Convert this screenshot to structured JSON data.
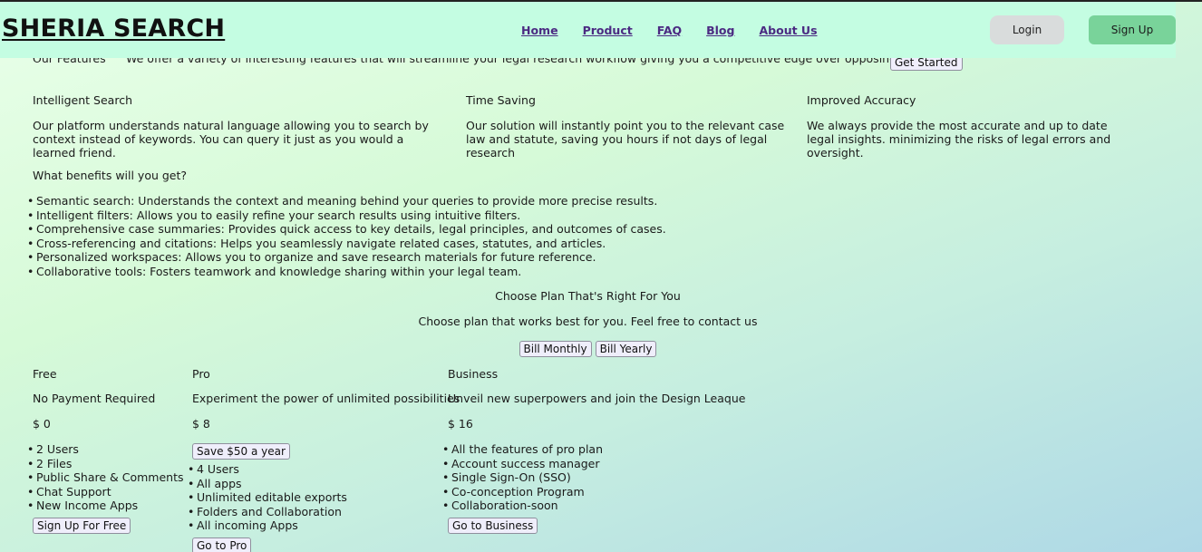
{
  "nav": {
    "logo": "SHERIA SEARCH",
    "links": [
      "Home",
      "Product",
      "FAQ",
      "Blog",
      "About Us"
    ],
    "login": "Login",
    "signup": "Sign Up"
  },
  "hero_partial": {
    "label": "Our Features",
    "desc": "We offer a variety of interesting features that will streamline your legal research workflow giving you a competitive edge over opposing counsel.",
    "get_started": "Get Started"
  },
  "features": [
    {
      "title": "Intelligent Search",
      "desc": "Our platform understands natural language allowing you to search by context instead of keywords. You can query it just as you would a learned friend."
    },
    {
      "title": "Time Saving",
      "desc": "Our solution will instantly point you to the relevant case law and statute, saving you hours if not days of legal research"
    },
    {
      "title": "Improved Accuracy",
      "desc": "We always provide the most accurate and up to date legal insights. minimizing the risks of legal errors and oversight."
    }
  ],
  "benefits": {
    "title": "What benefits will you get?",
    "items": [
      "Semantic search: Understands the context and meaning behind your queries to provide more precise results.",
      "Intelligent filters: Allows you to easily refine your search results using intuitive filters.",
      "Comprehensive case summaries: Provides quick access to key details, legal principles, and outcomes of cases.",
      "Cross-referencing and citations: Helps you seamlessly navigate related cases, statutes, and articles.",
      "Personalized workspaces: Allows you to organize and save research materials for future reference.",
      "Collaborative tools: Fosters teamwork and knowledge sharing within your legal team."
    ]
  },
  "pricing": {
    "title": "Choose Plan That's Right For You",
    "subtitle": "Choose plan that works best for you. Feel free to contact us",
    "bill_monthly": "Bill Monthly",
    "bill_yearly": "Bill Yearly",
    "plans": [
      {
        "name": "Free",
        "tagline": "No Payment Required",
        "price": "$ 0",
        "features": [
          "2 Users",
          "2 Files",
          "Public Share & Comments",
          "Chat Support",
          "New Income Apps"
        ],
        "cta": "Sign Up For Free"
      },
      {
        "name": "Pro",
        "tagline": "Experiment the power of unlimited possibilities",
        "price": "$ 8",
        "save": "Save $50 a year",
        "features": [
          "4 Users",
          "All apps",
          "Unlimited editable exports",
          "Folders and Collaboration",
          "All incoming Apps"
        ],
        "cta": "Go to Pro"
      },
      {
        "name": "Business",
        "tagline": "Unveil new superpowers and join the Design Leaque",
        "price": "$ 16",
        "features": [
          "All the features of pro plan",
          "Account success manager",
          "Single Sign-On (SSO)",
          "Co-conception Program",
          "Collaboration-soon"
        ],
        "cta": "Go to Business"
      }
    ]
  }
}
